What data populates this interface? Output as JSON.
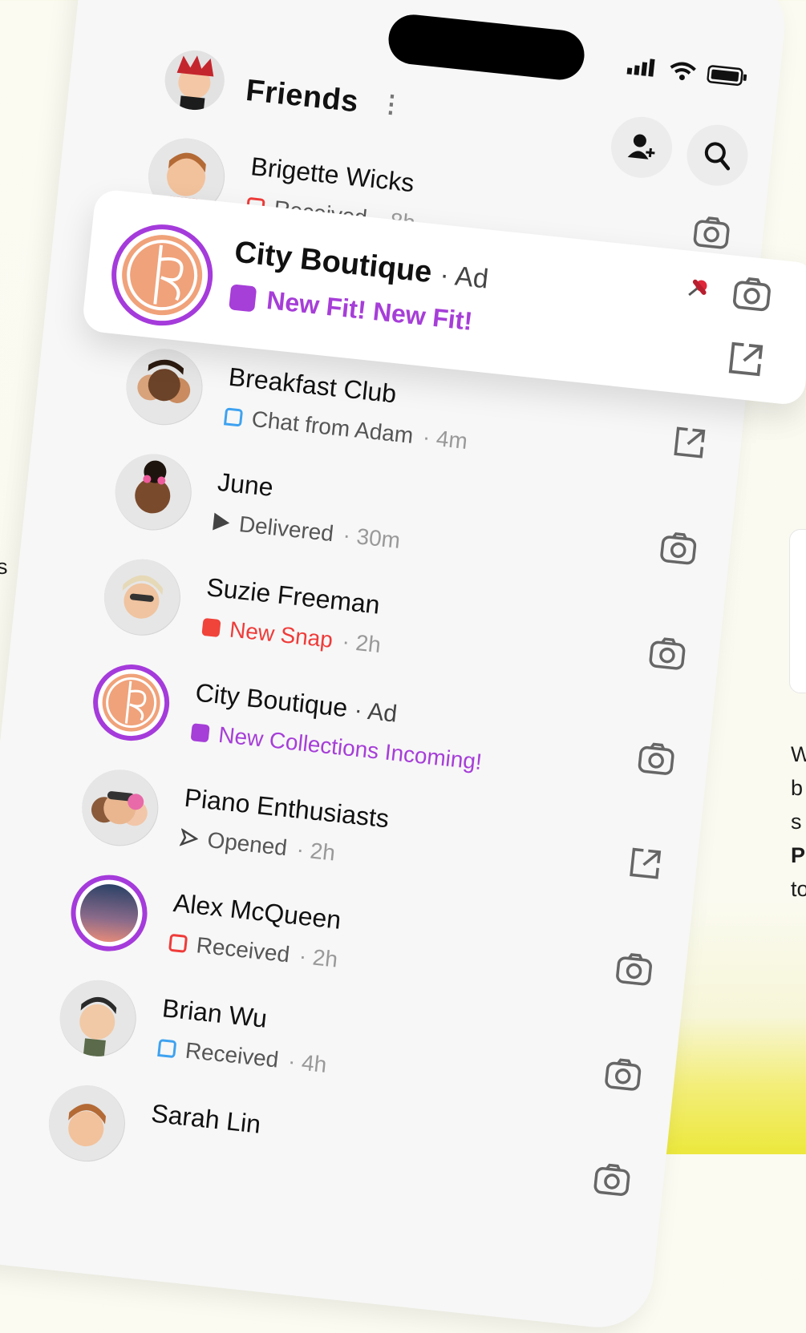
{
  "side": {
    "left_fragment": "s",
    "right_lines": [
      "W",
      "b",
      "s",
      "P",
      "to"
    ]
  },
  "header": {
    "title": "Friends",
    "menu_icon": "vertical-dots-icon",
    "add_friend_icon": "add-friend-icon",
    "search_icon": "search-icon"
  },
  "status_bar": {
    "icons": [
      "signal-icon",
      "wifi-icon",
      "battery-icon"
    ]
  },
  "float_card": {
    "name": "City Boutique",
    "tag": "· Ad",
    "subtitle": "New Fit! New Fit!",
    "pin_icon": "pin-icon",
    "camera_icon": "camera-icon",
    "external_icon": "external-link-icon"
  },
  "rows": [
    {
      "name": "Brigette Wicks",
      "status": "Received",
      "time": "· 8h",
      "kind": "outline-red",
      "action": "camera-icon"
    },
    {
      "name": "Breakfast Club",
      "status": "Chat from Adam",
      "time": "· 4m",
      "kind": "outline-blue",
      "action": "external-link-icon"
    },
    {
      "name": "June",
      "status": "Delivered",
      "time": "· 30m",
      "kind": "tri",
      "action": "camera-icon"
    },
    {
      "name": "Suzie Freeman",
      "status": "New Snap",
      "time": "· 2h",
      "kind": "fill-red",
      "action": "camera-icon"
    },
    {
      "name": "City Boutique",
      "tag": "· Ad",
      "status": "New Collections Incoming!",
      "time": "",
      "kind": "fill-purple",
      "action": "camera-icon"
    },
    {
      "name": "Piano Enthusiasts",
      "status": "Opened",
      "time": "· 2h",
      "kind": "tri-open",
      "action": "external-link-icon"
    },
    {
      "name": "Alex McQueen",
      "status": "Received",
      "time": "· 2h",
      "kind": "outline-red",
      "action": "camera-icon"
    },
    {
      "name": "Brian Wu",
      "status": "Received",
      "time": "· 4h",
      "kind": "outline-blue",
      "action": "camera-icon"
    },
    {
      "name": "Sarah Lin",
      "status": "",
      "time": "",
      "kind": "none",
      "action": "camera-icon"
    }
  ]
}
